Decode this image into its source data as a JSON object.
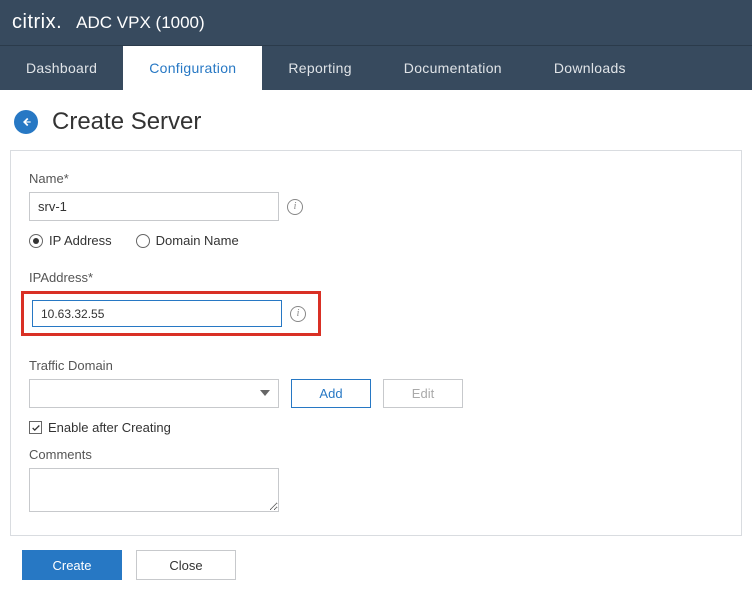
{
  "header": {
    "brand_prefix": "citri",
    "brand_suffix": "x",
    "product_name": "ADC VPX (1000)"
  },
  "nav": {
    "tabs": [
      {
        "label": "Dashboard",
        "active": false
      },
      {
        "label": "Configuration",
        "active": true
      },
      {
        "label": "Reporting",
        "active": false
      },
      {
        "label": "Documentation",
        "active": false
      },
      {
        "label": "Downloads",
        "active": false
      }
    ]
  },
  "page": {
    "title": "Create Server"
  },
  "form": {
    "name_label": "Name",
    "name_value": "srv-1",
    "address_mode": {
      "ip_label": "IP Address",
      "domain_label": "Domain Name",
      "selected": "ip"
    },
    "ip_label": "IPAddress",
    "ip_value": "10.63.32.55",
    "traffic_domain_label": "Traffic Domain",
    "traffic_domain_value": "",
    "add_button": "Add",
    "edit_button": "Edit",
    "enable_checkbox_label": "Enable after Creating",
    "enable_checked": true,
    "comments_label": "Comments",
    "comments_value": ""
  },
  "footer": {
    "create_label": "Create",
    "close_label": "Close"
  }
}
